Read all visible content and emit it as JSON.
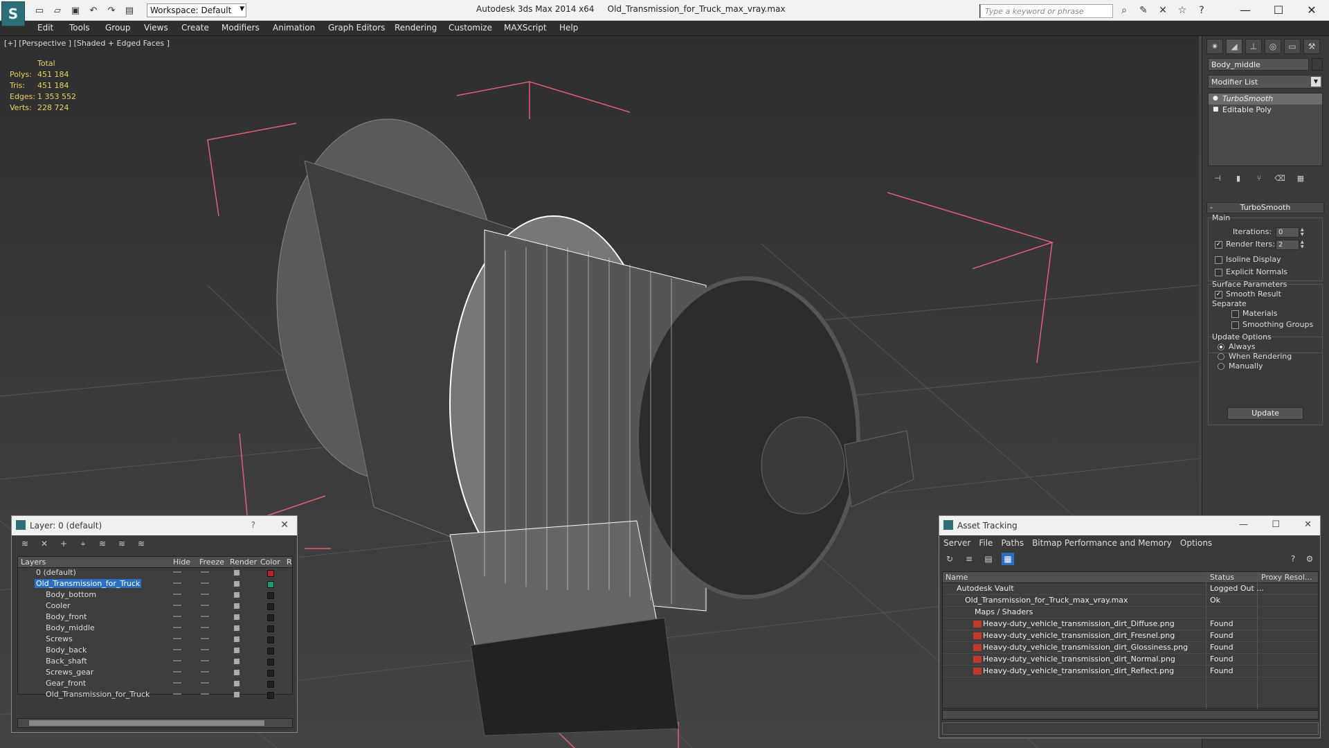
{
  "titlebar": {
    "workspace_label": "Workspace: Default",
    "app_title": "Autodesk 3ds Max  2014 x64",
    "file_name": "Old_Transmission_for_Truck_max_vray.max",
    "search_placeholder": "Type a keyword or phrase"
  },
  "menu": [
    "Edit",
    "Tools",
    "Group",
    "Views",
    "Create",
    "Modifiers",
    "Animation",
    "Graph Editors",
    "Rendering",
    "Customize",
    "MAXScript",
    "Help"
  ],
  "viewport": {
    "label": "[+] [Perspective ] [Shaded + Edged Faces ]",
    "stats_header": "Total",
    "stats": [
      {
        "label": "Polys:",
        "value": "451 184"
      },
      {
        "label": "Tris:",
        "value": "451 184"
      },
      {
        "label": "Edges:",
        "value": "1 353 552"
      },
      {
        "label": "Verts:",
        "value": "228 724"
      }
    ]
  },
  "command_panel": {
    "object_name": "Body_middle",
    "modifier_list": "Modifier List",
    "stack": [
      "TurboSmooth",
      "Editable Poly"
    ],
    "rollout_title": "TurboSmooth",
    "main_label": "Main",
    "iterations_label": "Iterations:",
    "iterations_value": "0",
    "render_iters_label": "Render Iters:",
    "render_iters_value": "2",
    "isoline_label": "Isoline Display",
    "explicit_normals_label": "Explicit Normals",
    "surface_params_label": "Surface Parameters",
    "smooth_result_label": "Smooth Result",
    "separate_label": "Separate",
    "materials_label": "Materials",
    "smoothing_groups_label": "Smoothing Groups",
    "update_options_label": "Update Options",
    "always_label": "Always",
    "when_rendering_label": "When Rendering",
    "manually_label": "Manually",
    "update_button": "Update"
  },
  "layer_window": {
    "title": "Layer: 0 (default)",
    "help": "?",
    "columns": [
      "Layers",
      "Hide",
      "Freeze",
      "Render",
      "Color",
      "R"
    ],
    "rows": [
      {
        "name": "0 (default)",
        "level": 0,
        "color": "#c0202a"
      },
      {
        "name": "Old_Transmission_for_Truck",
        "level": 0,
        "color": "#1a9a7a"
      },
      {
        "name": "Body_bottom",
        "level": 1,
        "color": "#222222"
      },
      {
        "name": "Cooler",
        "level": 1,
        "color": "#222222"
      },
      {
        "name": "Body_front",
        "level": 1,
        "color": "#222222"
      },
      {
        "name": "Body_middle",
        "level": 1,
        "color": "#222222"
      },
      {
        "name": "Screws",
        "level": 1,
        "color": "#222222"
      },
      {
        "name": "Body_back",
        "level": 1,
        "color": "#222222"
      },
      {
        "name": "Back_shaft",
        "level": 1,
        "color": "#222222"
      },
      {
        "name": "Screws_gear",
        "level": 1,
        "color": "#222222"
      },
      {
        "name": "Gear_front",
        "level": 1,
        "color": "#222222"
      },
      {
        "name": "Old_Transmission_for_Truck",
        "level": 1,
        "color": "#222222"
      }
    ]
  },
  "asset_window": {
    "title": "Asset Tracking",
    "menu": [
      "Server",
      "File",
      "Paths",
      "Bitmap Performance and Memory",
      "Options"
    ],
    "columns": [
      "Name",
      "Status",
      "Proxy Resol..."
    ],
    "rows": [
      {
        "name": "Autodesk Vault",
        "status": "Logged Out ..."
      },
      {
        "name": "Old_Transmission_for_Truck_max_vray.max",
        "status": "Ok"
      },
      {
        "name": "Maps / Shaders",
        "status": ""
      },
      {
        "name": "Heavy-duty_vehicle_transmission_dirt_Diffuse.png",
        "status": "Found"
      },
      {
        "name": "Heavy-duty_vehicle_transmission_dirt_Fresnel.png",
        "status": "Found"
      },
      {
        "name": "Heavy-duty_vehicle_transmission_dirt_Glossiness.png",
        "status": "Found"
      },
      {
        "name": "Heavy-duty_vehicle_transmission_dirt_Normal.png",
        "status": "Found"
      },
      {
        "name": "Heavy-duty_vehicle_transmission_dirt_Reflect.png",
        "status": "Found"
      }
    ]
  },
  "colors": {
    "accent": "#2b70c0",
    "stats": "#f0d060",
    "bounding_box": "#e0607a"
  }
}
